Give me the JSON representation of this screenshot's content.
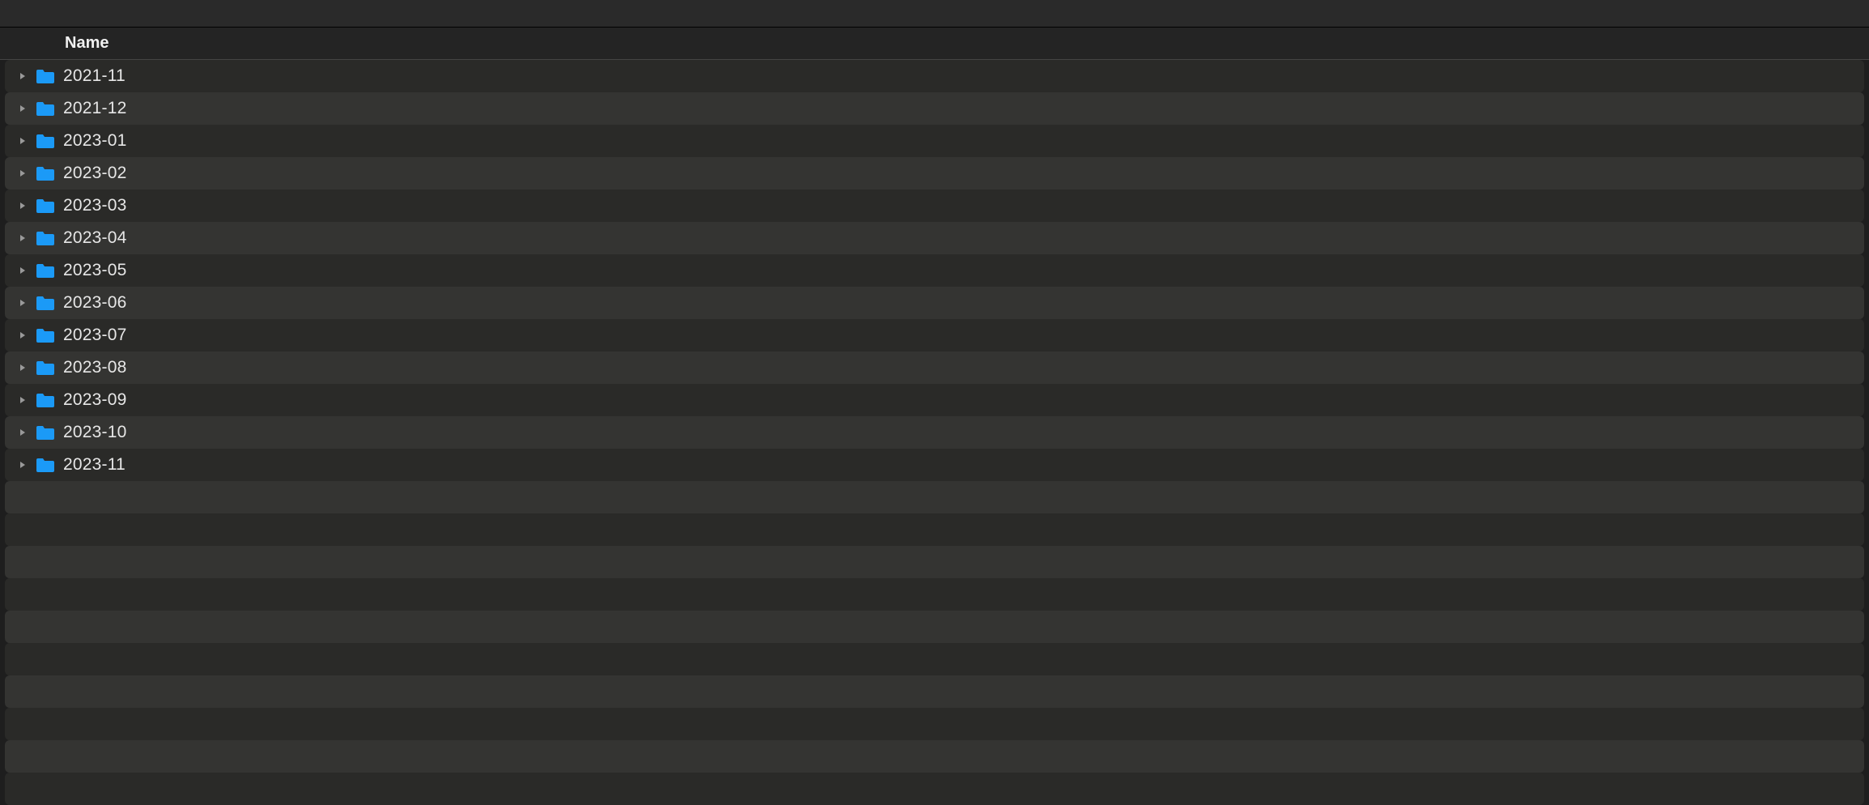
{
  "columns": {
    "name": "Name"
  },
  "items": [
    {
      "label": "2021-11",
      "type": "folder",
      "expanded": false
    },
    {
      "label": "2021-12",
      "type": "folder",
      "expanded": false
    },
    {
      "label": "2023-01",
      "type": "folder",
      "expanded": false
    },
    {
      "label": "2023-02",
      "type": "folder",
      "expanded": false
    },
    {
      "label": "2023-03",
      "type": "folder",
      "expanded": false
    },
    {
      "label": "2023-04",
      "type": "folder",
      "expanded": false
    },
    {
      "label": "2023-05",
      "type": "folder",
      "expanded": false
    },
    {
      "label": "2023-06",
      "type": "folder",
      "expanded": false
    },
    {
      "label": "2023-07",
      "type": "folder",
      "expanded": false
    },
    {
      "label": "2023-08",
      "type": "folder",
      "expanded": false
    },
    {
      "label": "2023-09",
      "type": "folder",
      "expanded": false
    },
    {
      "label": "2023-10",
      "type": "folder",
      "expanded": false
    },
    {
      "label": "2023-11",
      "type": "folder",
      "expanded": false
    }
  ],
  "colors": {
    "folder": "#1b9af7"
  }
}
